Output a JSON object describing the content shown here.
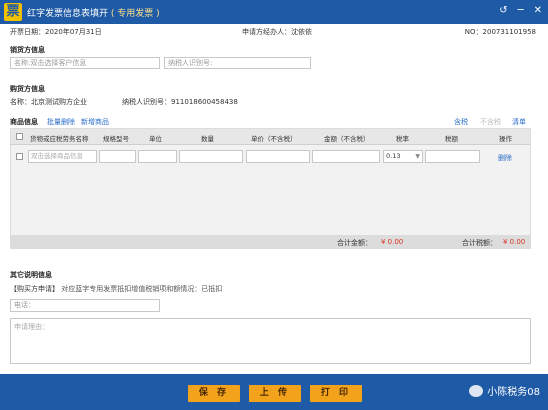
{
  "window": {
    "title": "红字发票信息表填开",
    "title_suffix": "( 专用发票 )",
    "logo_char": "票",
    "controls": [
      "↺",
      "─",
      "✕"
    ]
  },
  "info": {
    "date": "开票日期：2020年07月31日",
    "agent": "申请方经办人：沈依依",
    "no": "NO：200731101958"
  },
  "seller_section": {
    "title": "销货方信息",
    "name_placeholder": "名称:双击选择客户信息",
    "tax_id_placeholder": "纳税人识别号:"
  },
  "buyer_section": {
    "title": "购货方信息",
    "name": "名称：北京测试购方企业",
    "tax_id": "纳税人识别号：911018600458438"
  },
  "goods": {
    "title": "商品信息",
    "batch_delete": "批量删除",
    "add_goods": "新增商品",
    "tax_included": "含税",
    "no_tax": "不含税",
    "clear": "清单",
    "columns": [
      "货物或应税劳务名称",
      "规格型号",
      "单位",
      "数量",
      "单价（不含税）",
      "金额（不含税）",
      "税率",
      "税额",
      "操作"
    ],
    "row": {
      "name_placeholder": "双击选择商品信息",
      "tax_rate": "0.13",
      "delete": "删除"
    },
    "total_amount_label": "合计金额：",
    "total_amount": "¥ 0.00",
    "total_tax_label": "合计税额：",
    "total_tax": "¥ 0.00"
  },
  "other": {
    "title": "其它说明信息",
    "note_prefix": "【购买方申请】",
    "note_text": "对应蓝字专用发票抵扣增值税销项和额情况：已抵扣",
    "phone_placeholder": "电话：",
    "reason_placeholder": "申请理由："
  },
  "buttons": {
    "save": "保 存",
    "upload": "上 传",
    "print": "打 印"
  },
  "watermark": "小陈税务08"
}
